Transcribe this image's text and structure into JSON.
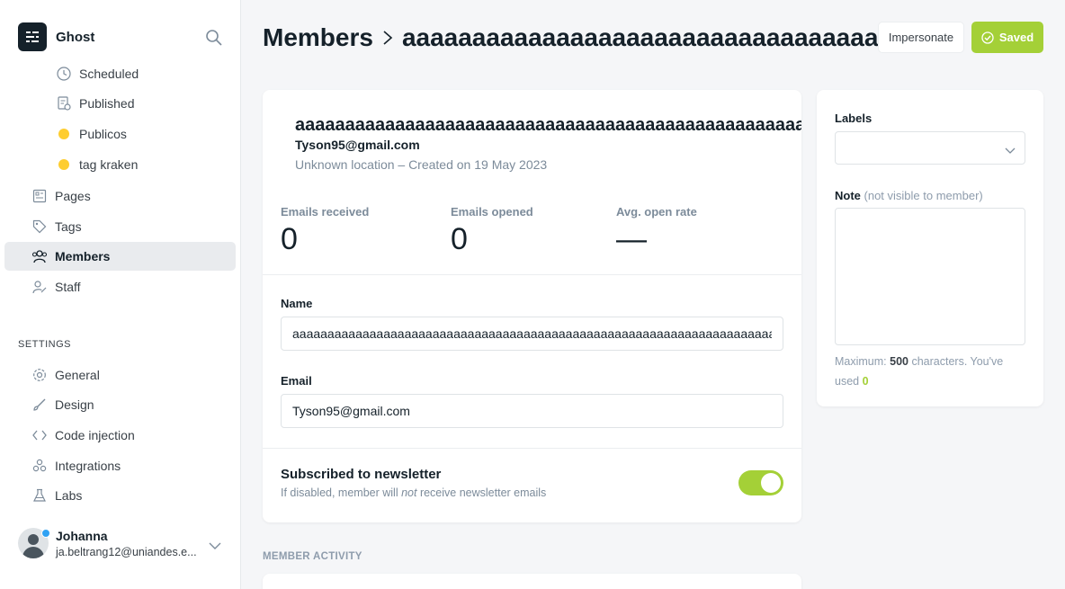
{
  "app": {
    "name": "Ghost"
  },
  "sidebar": {
    "sub_items": [
      {
        "label": "Scheduled",
        "icon": "clock-icon"
      },
      {
        "label": "Published",
        "icon": "published-doc-icon"
      },
      {
        "label": "Publicos",
        "icon": "tag-dot-icon",
        "color": "#fecd30"
      },
      {
        "label": "tag kraken",
        "icon": "tag-dot-icon",
        "color": "#fecd30"
      }
    ],
    "items": [
      {
        "label": "Pages",
        "icon": "pages-icon"
      },
      {
        "label": "Tags",
        "icon": "tag-icon"
      },
      {
        "label": "Members",
        "icon": "members-icon",
        "active": true
      },
      {
        "label": "Staff",
        "icon": "staff-icon"
      }
    ],
    "settings_heading": "SETTINGS",
    "settings_items": [
      {
        "label": "General",
        "icon": "gear-icon"
      },
      {
        "label": "Design",
        "icon": "brush-icon"
      },
      {
        "label": "Code injection",
        "icon": "code-icon"
      },
      {
        "label": "Integrations",
        "icon": "integrations-icon"
      },
      {
        "label": "Labs",
        "icon": "flask-icon"
      }
    ],
    "user": {
      "name": "Johanna",
      "email": "ja.beltrang12@uniandes.e..."
    }
  },
  "header": {
    "breadcrumb_root": "Members",
    "breadcrumb_current": "aaaaaaaaaaaaaaaaaaaaaaaaaaaaaaaaaaaaaaaaaaaaaaaaaaaaaaaaaaaaaaaaaaaaaaaaaa",
    "impersonate_label": "Impersonate",
    "saved_label": "Saved"
  },
  "member": {
    "name": "aaaaaaaaaaaaaaaaaaaaaaaaaaaaaaaaaaaaaaaaaaaaaaaaaaaaaaaaaaaaaaaaaaaaaaaaaa",
    "email": "Tyson95@gmail.com",
    "meta": "Unknown location – Created on 19 May 2023",
    "stats": {
      "emails_received_label": "Emails received",
      "emails_received": "0",
      "emails_opened_label": "Emails opened",
      "emails_opened": "0",
      "open_rate_label": "Avg. open rate",
      "open_rate": "—"
    }
  },
  "form": {
    "name_label": "Name",
    "name_value": "aaaaaaaaaaaaaaaaaaaaaaaaaaaaaaaaaaaaaaaaaaaaaaaaaaaaaaaaaaaaaaaaaaaaaaaaaa",
    "email_label": "Email",
    "email_value": "Tyson95@gmail.com",
    "newsletter_title": "Subscribed to newsletter",
    "newsletter_desc_pre": "If disabled, member will ",
    "newsletter_desc_em": "not",
    "newsletter_desc_post": " receive newsletter emails",
    "newsletter_enabled": true
  },
  "side": {
    "labels_label": "Labels",
    "note_label": "Note",
    "note_hint": "(not visible to member)",
    "note_value": "",
    "max_pre": "Maximum: ",
    "max_count": "500",
    "max_mid": " characters. You've used ",
    "used_count": "0"
  },
  "activity": {
    "heading": "MEMBER ACTIVITY"
  },
  "colors": {
    "accent": "#a4d037",
    "tag_dot": "#fecd30",
    "notification": "#30a2f3"
  }
}
